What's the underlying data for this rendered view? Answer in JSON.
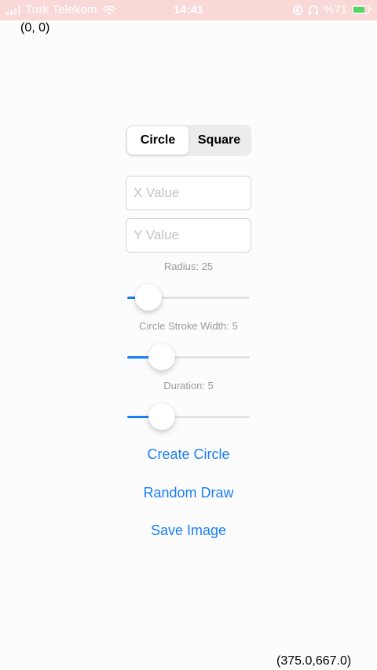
{
  "status_bar": {
    "carrier": "Turk Telekom",
    "time": "14:41",
    "battery_percent": "%71",
    "battery_level": 0.71,
    "icons": [
      "signal-icon",
      "wifi-icon",
      "screen-rotation-lock-icon",
      "headphones-icon",
      "battery-icon"
    ]
  },
  "coordinates": {
    "top_left": "(0, 0)",
    "bottom_right": "(375.0,667.0)"
  },
  "shape_selector": {
    "options": [
      "Circle",
      "Square"
    ],
    "selected": "Circle"
  },
  "fields": {
    "x": {
      "value": "",
      "placeholder": "X Value"
    },
    "y": {
      "value": "",
      "placeholder": "Y Value"
    }
  },
  "sliders": [
    {
      "label": "Radius: 25",
      "fraction": 0.17
    },
    {
      "label": "Circle Stroke Width: 5",
      "fraction": 0.28
    },
    {
      "label": "Duration: 5",
      "fraction": 0.28
    }
  ],
  "buttons": {
    "create": "Create Circle",
    "random": "Random Draw",
    "save": "Save Image"
  },
  "colors": {
    "accent": "#1a7ff5",
    "status_bar": "#f9d8d8",
    "battery": "#4cd964"
  }
}
